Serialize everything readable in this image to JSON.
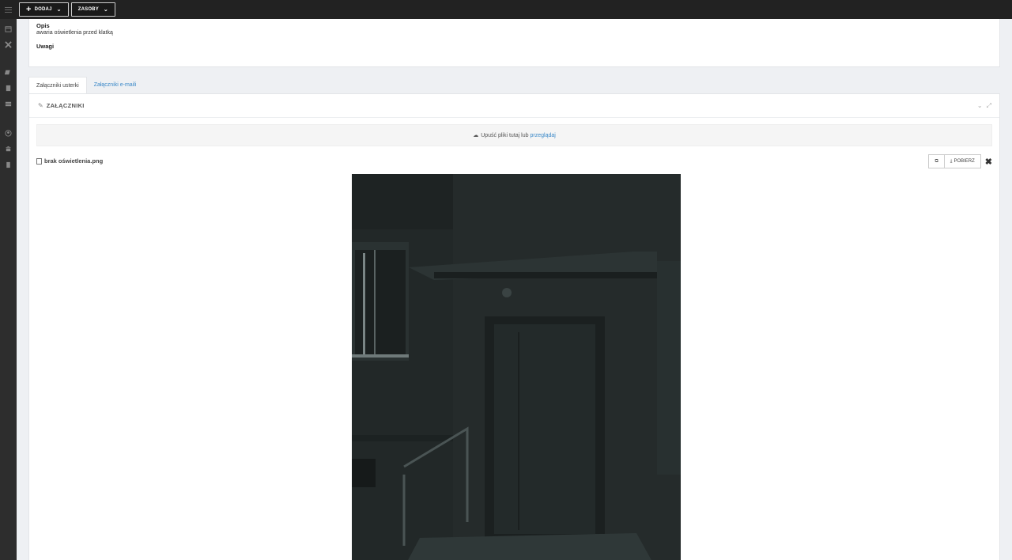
{
  "topbar": {
    "add_label": "DODAJ",
    "resources_label": "ZASOBY"
  },
  "details": {
    "description_label": "Opis",
    "description_value": "awaria oświetlenia przed klatką",
    "notes_label": "Uwagi"
  },
  "tabs": [
    {
      "label": "Załączniki usterki",
      "active": true
    },
    {
      "label": "Załączniki e-maili",
      "active": false
    }
  ],
  "attachments": {
    "title": "ZAŁĄCZNIKI",
    "dropzone_text": "Upuść pliki tutaj lub",
    "dropzone_link": "przeglądaj",
    "file_name": "brak oświetlenia.png",
    "download_label": "POBIERZ"
  },
  "colors": {
    "topbar": "#222222",
    "sidebar": "#2d2d2d",
    "link": "#3a88c8",
    "photo": "#1f2525"
  }
}
